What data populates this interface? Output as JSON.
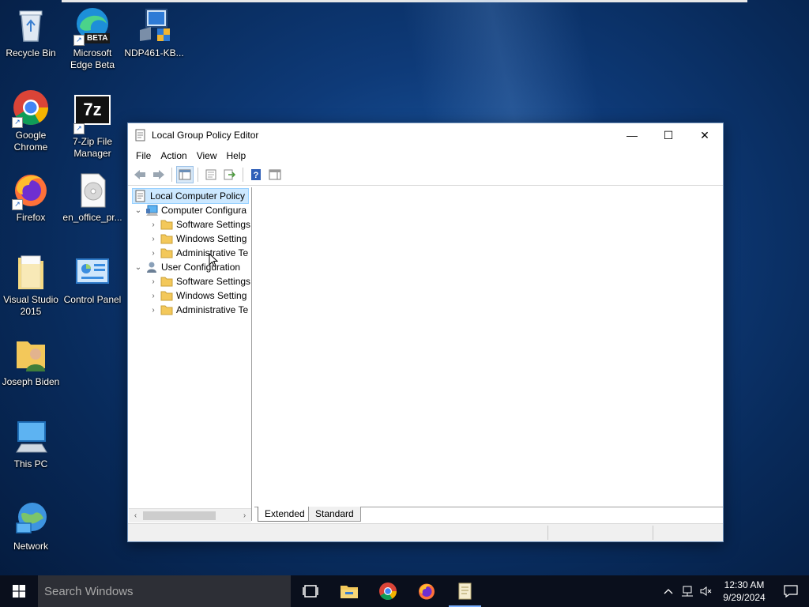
{
  "desktop": {
    "icons": [
      {
        "label": "Recycle Bin"
      },
      {
        "label": "Microsoft Edge Beta",
        "badge": "BETA"
      },
      {
        "label": "NDP461-KB..."
      },
      {
        "label": "Google Chrome"
      },
      {
        "label": "7-Zip File Manager",
        "glyph": "7z"
      },
      {
        "label": "Firefox"
      },
      {
        "label": "en_office_pr..."
      },
      {
        "label": "Visual Studio 2015"
      },
      {
        "label": "Control Panel"
      },
      {
        "label": "Joseph Biden"
      },
      {
        "label": "This PC"
      },
      {
        "label": "Network"
      }
    ]
  },
  "window": {
    "title": "Local Group Policy Editor",
    "controls": {
      "minimize": "—",
      "maximize": "☐",
      "close": "✕"
    },
    "menu": [
      "File",
      "Action",
      "View",
      "Help"
    ],
    "tree": {
      "root": "Local Computer Policy",
      "computer": "Computer Configura",
      "computer_children": [
        "Software Settings",
        "Windows Setting",
        "Administrative Te"
      ],
      "user": "User Configuration",
      "user_children": [
        "Software Settings",
        "Windows Setting",
        "Administrative Te"
      ]
    },
    "tabs": {
      "extended": "Extended",
      "standard": "Standard"
    }
  },
  "taskbar": {
    "search_placeholder": "Search Windows",
    "time": "12:30 AM",
    "date": "9/29/2024"
  },
  "colors": {
    "accent": "#0078d7",
    "selection": "#cce8ff",
    "taskbar": "#0a0f1c"
  }
}
